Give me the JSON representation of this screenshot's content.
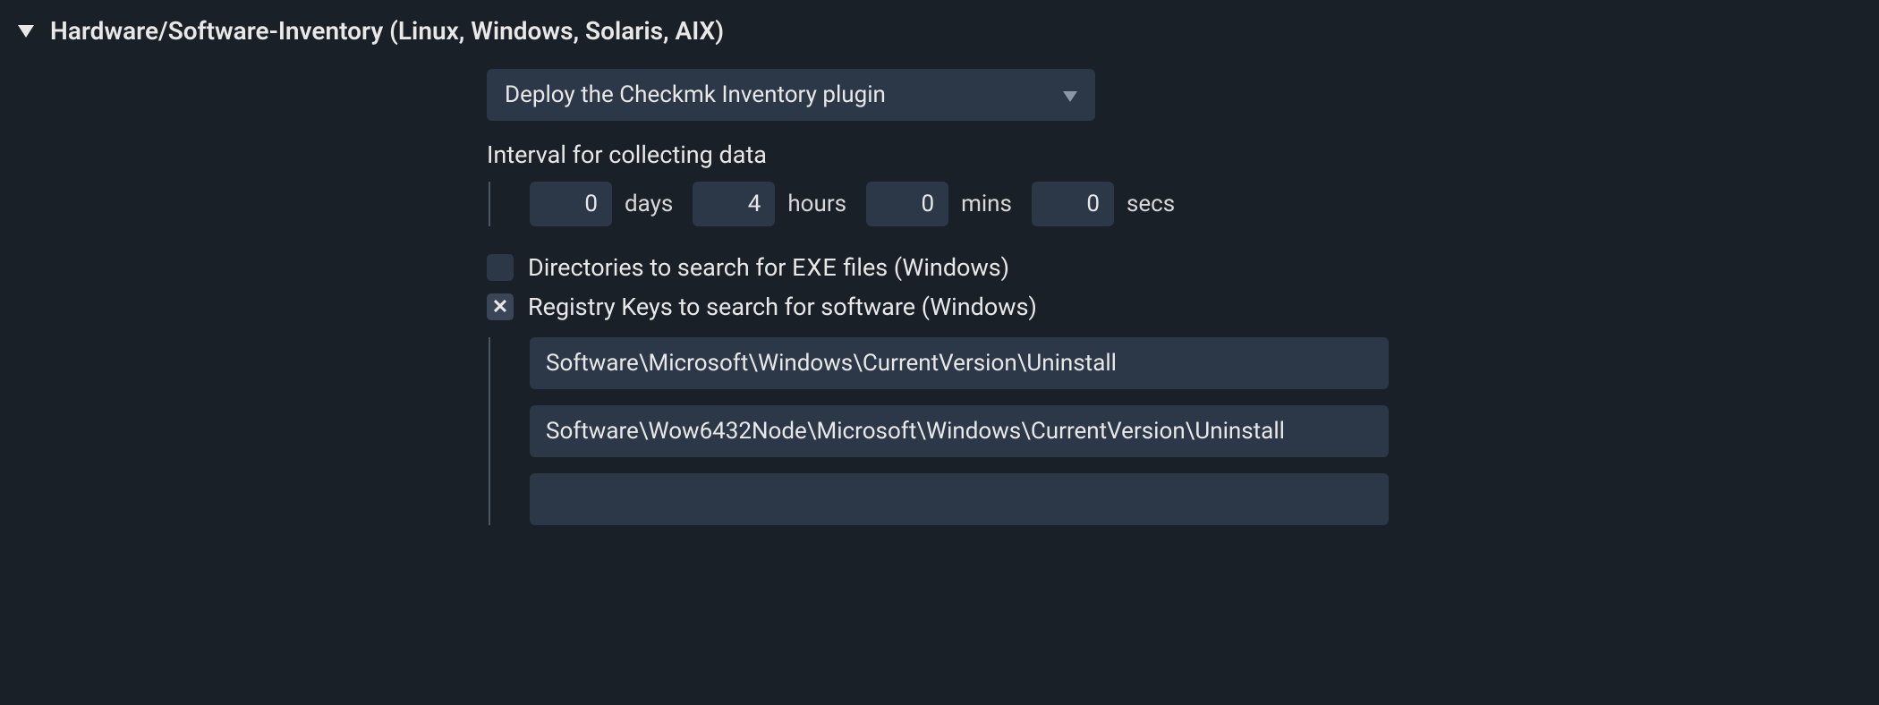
{
  "section": {
    "title": "Hardware/Software-Inventory (Linux, Windows, Solaris, AIX)"
  },
  "dropdown": {
    "selected": "Deploy the Checkmk Inventory plugin"
  },
  "interval": {
    "label": "Interval for collecting data",
    "days": "0",
    "hours": "4",
    "mins": "0",
    "secs": "0",
    "unit_days": "days",
    "unit_hours": "hours",
    "unit_mins": "mins",
    "unit_secs": "secs"
  },
  "options": {
    "exe_dirs": {
      "checked": false,
      "label_pre": "Directories to search for ",
      "label_exe": "EXE",
      "label_post": " files (Windows)"
    },
    "registry": {
      "checked": true,
      "label": "Registry Keys to search for software (Windows)",
      "entries": [
        "Software\\Microsoft\\Windows\\CurrentVersion\\Uninstall",
        "Software\\Wow6432Node\\Microsoft\\Windows\\CurrentVersion\\Uninstall",
        ""
      ]
    }
  }
}
